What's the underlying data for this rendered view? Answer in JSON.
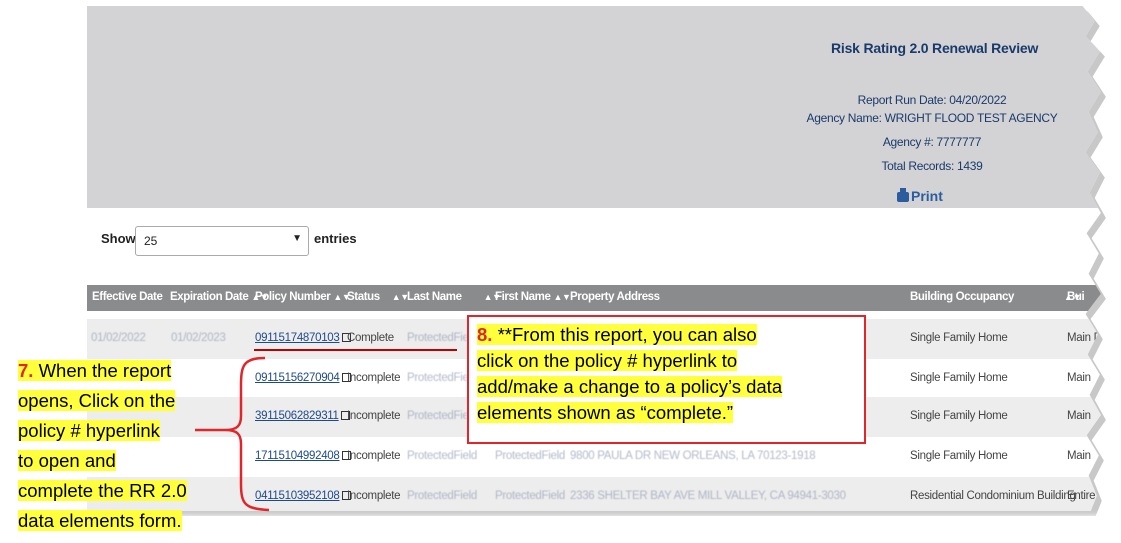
{
  "report": {
    "title": "Risk Rating 2.0 Renewal Review",
    "run_date": "Report Run Date: 04/20/2022",
    "agency_name": "Agency Name: WRIGHT FLOOD TEST AGENCY",
    "agency_number": "Agency #: 7777777",
    "total_records": "Total Records: 1439",
    "print_label": "Print"
  },
  "entries": {
    "show_label": "Show",
    "selected": "25",
    "suffix_label": "entries"
  },
  "table": {
    "columns": [
      "Effective Date",
      "Expiration Date",
      "Policy Number",
      "Status",
      "Last Name",
      "First Name",
      "Property Address",
      "Building Occupancy",
      "Bui"
    ],
    "rows": [
      {
        "effective": "01/02/2022",
        "expiration": "01/02/2023",
        "policy": "09115174870103",
        "status": "Complete",
        "last": "ProtectedField",
        "first": "",
        "address": "",
        "occupancy": "Single Family Home",
        "building": "Main D"
      },
      {
        "effective": "",
        "expiration": "",
        "policy": "09115156270904",
        "status": "Incomplete",
        "last": "ProtectedField",
        "first": "",
        "address": "",
        "occupancy": "Single Family Home",
        "building": "Main"
      },
      {
        "effective": "",
        "expiration": "",
        "policy": "39115062829311",
        "status": "Incomplete",
        "last": "ProtectedField",
        "first": "",
        "address": "",
        "occupancy": "Single Family Home",
        "building": "Main"
      },
      {
        "effective": "",
        "expiration": "",
        "policy": "17115104992408",
        "status": "Incomplete",
        "last": "ProtectedField",
        "first": "ProtectedField",
        "address": "9800 PAULA DR NEW ORLEANS, LA 70123-1918",
        "occupancy": "Single Family Home",
        "building": "Main"
      },
      {
        "effective": "",
        "expiration": "",
        "policy": "04115103952108",
        "status": "Incomplete",
        "last": "ProtectedField",
        "first": "ProtectedField",
        "address": "2336 SHELTER BAY AVE MILL VALLEY, CA 94941-3030",
        "occupancy": "Residential Condominium Building",
        "building": "Entire"
      }
    ]
  },
  "annotations": {
    "step8_number": "8.",
    "step8_text_1": " **From this report, you can also",
    "step8_text_2": "click on the policy # hyperlink to",
    "step8_text_3": "add/make a change to a policy’s data",
    "step8_text_4": "elements shown as “complete.”",
    "step7_number": "7.",
    "step7_text_1": " When the report",
    "step7_text_2": "opens, Click on the",
    "step7_text_3": "policy # hyperlink",
    "step7_text_4": "to open and",
    "step7_text_5": "complete the RR 2.0",
    "step7_text_6": "data elements form."
  },
  "colors": {
    "header_bg": "#d3d3d5",
    "table_head": "#8a8b8d",
    "link": "#1f4a8a",
    "callout_border": "#e0262b",
    "highlight": "#ffff3c"
  }
}
